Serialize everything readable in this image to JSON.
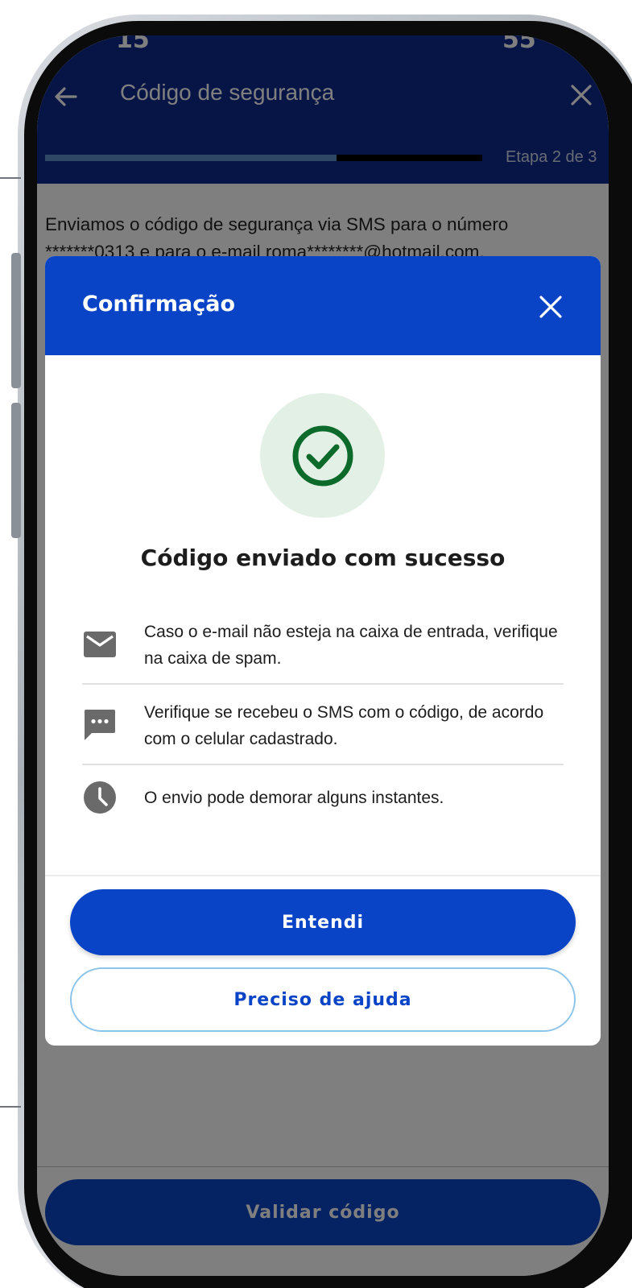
{
  "status_bar": {
    "time_fragment": "15",
    "battery_fragment": "55"
  },
  "header": {
    "title": "Código de segurança",
    "step_label": "Etapa 2 de 3",
    "progress_fraction": 0.667
  },
  "intro": {
    "text": "Enviamos o código de segurança via SMS para o número *******0313 e para o e-mail roma********@hotmail.com."
  },
  "validate_button_label": "Validar código",
  "modal": {
    "title": "Confirmação",
    "success_icon": "check-circle-icon",
    "success_title": "Código enviado com sucesso",
    "items": [
      {
        "icon": "mail-icon",
        "text": "Caso o e-mail não esteja na caixa de entrada, verifique na caixa de spam."
      },
      {
        "icon": "sms-icon",
        "text": "Verifique se recebeu o SMS com o código, de acordo com o celular cadastrado."
      },
      {
        "icon": "clock-icon",
        "text": "O envio pode demorar alguns instantes."
      }
    ],
    "primary_button": "Entendi",
    "secondary_button": "Preciso de ajuda"
  },
  "colors": {
    "brand_blue": "#0a44c6",
    "header_blue": "#0e2a8c",
    "success_green": "#0c6a2a",
    "success_bg": "#e3f0e6",
    "icon_gray": "#6a6a6a"
  }
}
